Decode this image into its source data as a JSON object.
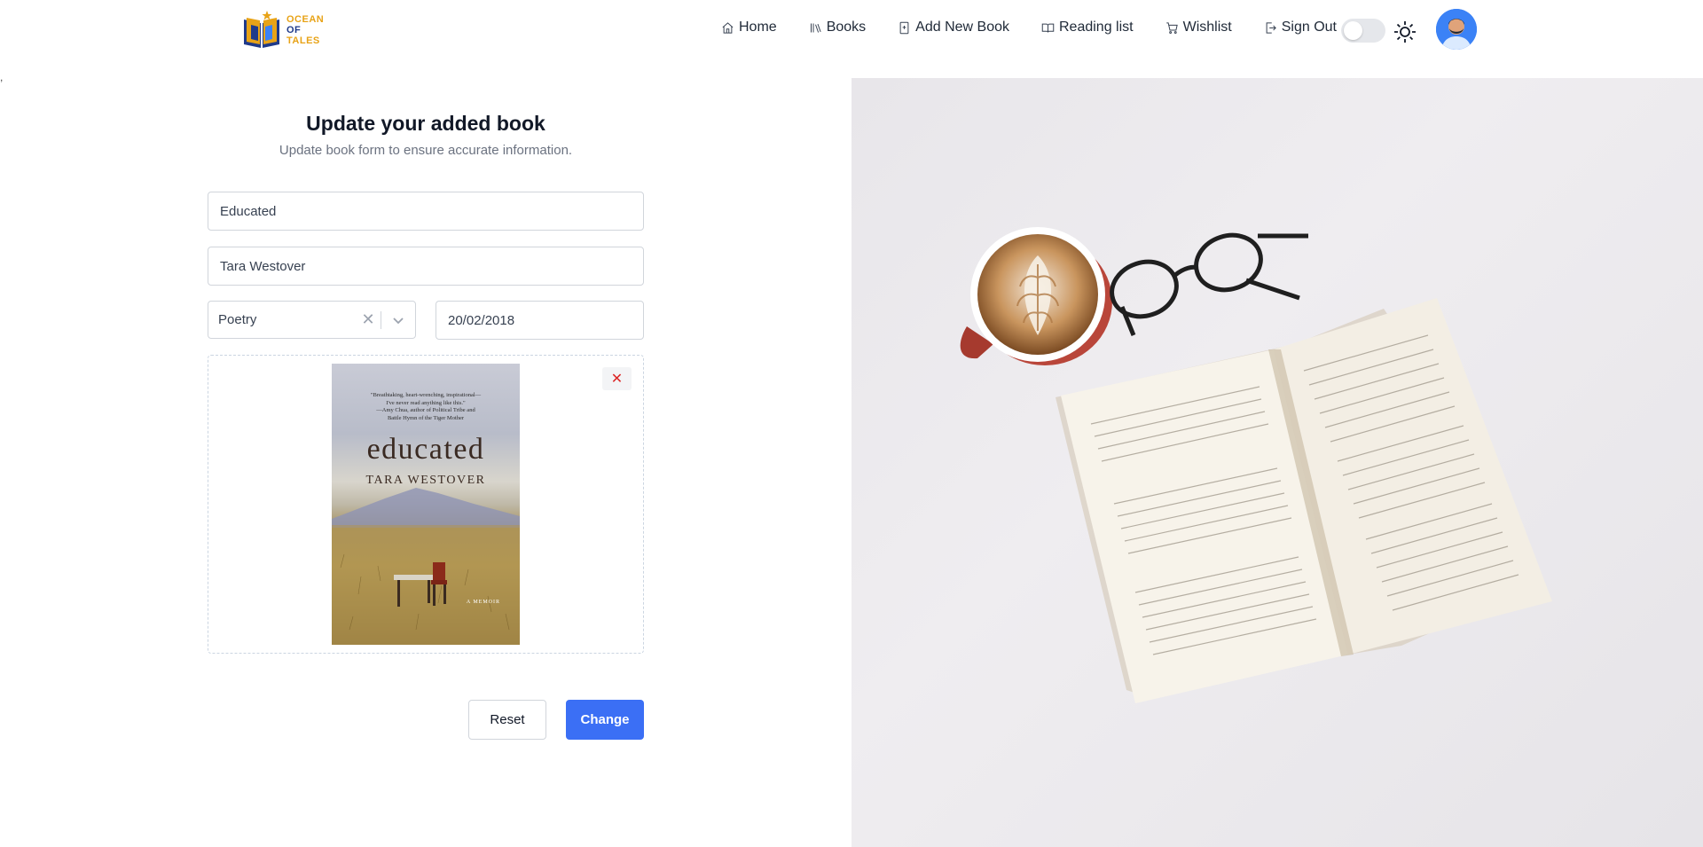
{
  "header": {
    "logo_lines": [
      "OCEAN",
      "OF",
      "TALES"
    ],
    "nav": [
      {
        "label": "Home",
        "icon": "home-icon"
      },
      {
        "label": "Books",
        "icon": "books-icon"
      },
      {
        "label": "Add New Book",
        "icon": "add-book-icon"
      },
      {
        "label": "Reading list",
        "icon": "reading-list-icon"
      },
      {
        "label": "Wishlist",
        "icon": "cart-icon"
      },
      {
        "label": "Sign Out",
        "icon": "sign-out-icon"
      }
    ],
    "theme_toggle_on": false
  },
  "stray_mark": ",",
  "form": {
    "title": "Update your added book",
    "subtitle": "Update book form to ensure accurate information.",
    "book_title_value": "Educated",
    "author_value": "Tara Westover",
    "genre_value": "Poetry",
    "date_value": "20/02/2018",
    "cover": {
      "quote_lines": [
        "\"Breathtaking, heart-wrenching, inspirational—",
        "I've never read anything like this.\"",
        "—Amy Chua, author of Political Tribe and",
        "Battle Hymn of the Tiger Mother"
      ],
      "title": "educated",
      "author": "TARA WESTOVER",
      "subtitle": "A MEMOIR"
    },
    "reset_label": "Reset",
    "change_label": "Change"
  },
  "colors": {
    "accent": "#3b6ff5",
    "danger": "#dc2626",
    "logo_gold": "#e8a317",
    "logo_navy": "#1f3a8a"
  }
}
